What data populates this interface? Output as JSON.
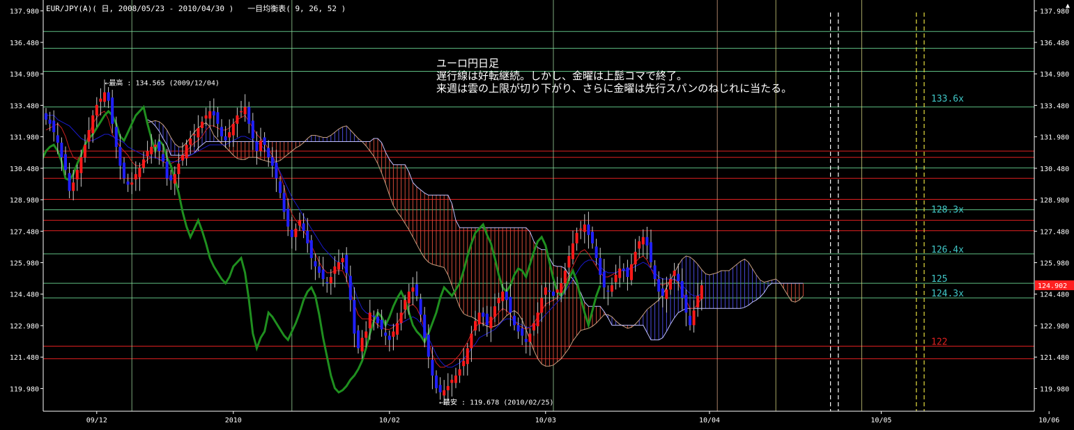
{
  "header": {
    "symbol": "EUR/JPY(A)",
    "period": "日",
    "range": "2008/05/23 - 2010/04/30",
    "indicator": "一目均衡表",
    "params": "9, 26, 52"
  },
  "comment": {
    "title": "ユーロ円日足",
    "line1": "遅行線は好転継続。しかし、金曜は上髭コマで終了。",
    "line2": "来週は雲の上限が切り下がり、さらに金曜は先行スパンのねじれに当たる。"
  },
  "close_icon": "close-triangle-icon",
  "colors": {
    "up": "#ff1a1a",
    "down": "#2020ff",
    "tenkan": "#cc2020",
    "kijun": "#1a1acc",
    "chikou": "#1f8f1f",
    "cloud_bull": "#4a4ad8",
    "cloud_bear": "#d04a38",
    "hline_green": "#7fffb0",
    "hline_red": "#e02020",
    "price_label": "#ff2020",
    "axis": "#ffffff"
  },
  "chart_data": {
    "type": "candlestick",
    "symbol": "EUR/JPY",
    "ylim": [
      118.9,
      138.5
    ],
    "y_ticks": [
      "137.980",
      "136.480",
      "134.980",
      "133.480",
      "131.980",
      "130.480",
      "128.980",
      "127.480",
      "125.980",
      "124.480",
      "122.980",
      "121.480",
      "119.980"
    ],
    "x_ticks": [
      "09/12",
      "2010",
      "10/02",
      "10/03",
      "10/04",
      "10/05",
      "10/06"
    ],
    "x_tick_index": [
      13,
      48,
      88,
      128,
      170,
      214,
      257
    ],
    "last_price": "124.902",
    "annotations": {
      "high": {
        "label": "最高",
        "value": "134.565",
        "date": "2009/12/04"
      },
      "low": {
        "label": "最安",
        "value": "119.678",
        "date": "2010/02/25"
      }
    },
    "levels": [
      {
        "label": "133.6x",
        "value": 133.6,
        "color": "#7fffb0"
      },
      {
        "label": "128.3x",
        "value": 128.3,
        "color": "#7fffb0"
      },
      {
        "label": "126.4x",
        "value": 126.4,
        "color": "#7fffb0"
      },
      {
        "label": "125",
        "value": 125.0,
        "color": "#7fffb0"
      },
      {
        "label": "124.3x",
        "value": 124.3,
        "color": "#7fffb0"
      },
      {
        "label": "122",
        "value": 122.0,
        "color": "#e02020"
      }
    ],
    "green_lines": [
      137.0,
      136.2,
      135.1,
      133.4,
      130.5,
      128.5,
      126.4,
      125.0,
      124.3
    ],
    "red_lines": [
      131.3,
      131.0,
      130.0,
      129.0,
      128.0,
      127.5,
      122.0,
      121.4
    ],
    "vlines": [
      {
        "i": 22,
        "color": "#9ad29a"
      },
      {
        "i": 63,
        "color": "#9ad29a"
      },
      {
        "i": 130,
        "color": "#9ad29a"
      },
      {
        "i": 172,
        "color": "#d4a080"
      },
      {
        "i": 187,
        "color": "#d4d480"
      },
      {
        "i": 209,
        "color": "#d4d480"
      }
    ],
    "dashed_vlines": [
      {
        "i": 201,
        "color": "#ffffff"
      },
      {
        "i": 203,
        "color": "#ffffff"
      },
      {
        "i": 223,
        "color": "#e8e040"
      },
      {
        "i": 225,
        "color": "#e8e040"
      }
    ],
    "closes": [
      132.8,
      132.6,
      132.2,
      131.7,
      131.0,
      130.4,
      129.4,
      129.8,
      130.4,
      131.0,
      131.6,
      132.3,
      133.0,
      133.5,
      133.8,
      134.1,
      133.7,
      132.6,
      131.5,
      130.6,
      130.0,
      129.7,
      129.8,
      130.2,
      130.5,
      130.9,
      131.3,
      131.5,
      131.6,
      131.3,
      130.8,
      130.0,
      129.9,
      130.2,
      130.7,
      131.1,
      131.6,
      131.9,
      132.1,
      132.4,
      132.7,
      133.0,
      133.2,
      133.0,
      132.6,
      132.0,
      131.8,
      132.2,
      132.6,
      133.0,
      133.2,
      133.4,
      132.6,
      131.9,
      131.3,
      131.8,
      131.6,
      131.0,
      130.6,
      130.0,
      129.3,
      128.4,
      127.7,
      127.2,
      127.6,
      128.0,
      127.5,
      126.9,
      126.2,
      125.8,
      125.5,
      125.2,
      125.0,
      125.3,
      125.8,
      126.0,
      126.2,
      125.5,
      124.2,
      122.6,
      121.9,
      122.4,
      122.7,
      123.6,
      123.4,
      123.1,
      122.8,
      122.5,
      122.3,
      122.7,
      123.1,
      123.6,
      124.2,
      124.6,
      124.8,
      124.4,
      123.5,
      122.4,
      121.5,
      120.6,
      120.0,
      119.8,
      119.9,
      120.1,
      120.4,
      120.6,
      120.9,
      121.3,
      121.9,
      122.6,
      123.2,
      123.6,
      123.4,
      123.0,
      123.4,
      123.9,
      124.3,
      124.6,
      124.2,
      123.6,
      123.0,
      122.7,
      122.5,
      122.2,
      122.6,
      123.1,
      123.6,
      124.3,
      124.8,
      124.6,
      124.4,
      124.7,
      125.0,
      125.6,
      126.3,
      126.9,
      127.4,
      127.6,
      127.8,
      127.3,
      126.9,
      126.2,
      125.4,
      124.8,
      124.6,
      124.9,
      125.4,
      125.7,
      125.6,
      125.3,
      125.9,
      126.5,
      127.0,
      127.2,
      126.8,
      126.0,
      125.2,
      124.6,
      124.4,
      124.7,
      125.2,
      125.6,
      125.1,
      124.3,
      123.6,
      123.0,
      123.7,
      124.4,
      124.9
    ],
    "tenkan": [
      132.3,
      132.4,
      132.5,
      132.6,
      132.4,
      132.0,
      131.4,
      131.0,
      130.9,
      131.1,
      131.6,
      132.1,
      132.6,
      132.9,
      133.1,
      133.2,
      132.8,
      132.1,
      131.8,
      131.5,
      131.3,
      131.1,
      130.8,
      130.6,
      130.6,
      130.7,
      130.9,
      131.0,
      131.0,
      130.9,
      130.8,
      130.7,
      130.7,
      130.8,
      130.9,
      131.1,
      131.3,
      131.5,
      131.7,
      131.8,
      132.0,
      132.3,
      132.5,
      132.5,
      132.4,
      132.3,
      132.3,
      132.4,
      132.6,
      132.8,
      132.9,
      133.0,
      132.7,
      132.4,
      132.1,
      131.9,
      131.7,
      131.4,
      131.1,
      130.7,
      130.2,
      129.6,
      128.9,
      128.3,
      128.0,
      127.8,
      127.5,
      127.2,
      126.8,
      126.4,
      126.0,
      125.7,
      125.5,
      125.5,
      125.6,
      125.6,
      125.6,
      125.2,
      124.6,
      124.0,
      123.5,
      123.3,
      123.3,
      123.3,
      123.2,
      123.0,
      122.9,
      122.8,
      122.8,
      122.9,
      123.1,
      123.4,
      123.7,
      123.9,
      124.0,
      123.8,
      123.4,
      122.8,
      122.2,
      121.6,
      121.2,
      121.0,
      121.0,
      121.1,
      121.2,
      121.4,
      121.6,
      121.9,
      122.2,
      122.6,
      122.9,
      123.1,
      123.1,
      123.1,
      123.2,
      123.4,
      123.6,
      123.8,
      123.7,
      123.5,
      123.2,
      123.0,
      122.9,
      122.8,
      122.9,
      123.1,
      123.4,
      123.7,
      124.0,
      124.1,
      124.2,
      124.3,
      124.6,
      125.0,
      125.4,
      125.8,
      126.2,
      126.5,
      126.6,
      126.4,
      126.1,
      125.8,
      125.5,
      125.3,
      125.3,
      125.4,
      125.5,
      125.6,
      125.6,
      125.6,
      125.8,
      126.0,
      126.2,
      126.3,
      126.1,
      125.7,
      125.3,
      125.0,
      124.9,
      125.0,
      125.1,
      125.2,
      125.0,
      124.6,
      124.2,
      123.8,
      123.8,
      124.0,
      124.3
    ],
    "kijun": [
      133.0,
      133.0,
      133.0,
      132.8,
      132.7,
      132.6,
      132.5,
      132.3,
      132.1,
      131.9,
      131.8,
      131.8,
      131.8,
      131.9,
      132.0,
      132.1,
      132.1,
      132.0,
      131.9,
      131.8,
      131.7,
      131.5,
      131.4,
      131.3,
      131.2,
      131.1,
      131.1,
      131.0,
      131.0,
      130.9,
      130.9,
      130.9,
      130.8,
      130.8,
      130.8,
      130.9,
      131.0,
      131.1,
      131.2,
      131.3,
      131.4,
      131.5,
      131.6,
      131.6,
      131.6,
      131.6,
      131.6,
      131.7,
      131.8,
      131.9,
      132.0,
      132.0,
      131.9,
      131.8,
      131.7,
      131.6,
      131.4,
      131.2,
      131.0,
      130.7,
      130.3,
      129.9,
      129.5,
      129.1,
      128.8,
      128.5,
      128.2,
      127.9,
      127.6,
      127.3,
      127.0,
      126.7,
      126.5,
      126.3,
      126.1,
      126.0,
      125.9,
      125.6,
      125.2,
      124.7,
      124.2,
      123.8,
      123.6,
      123.5,
      123.4,
      123.3,
      123.2,
      123.1,
      123.0,
      123.0,
      123.0,
      123.1,
      123.2,
      123.3,
      123.4,
      123.3,
      123.1,
      122.8,
      122.4,
      122.0,
      121.6,
      121.3,
      121.1,
      121.0,
      121.0,
      121.1,
      121.2,
      121.4,
      121.6,
      121.9,
      122.1,
      122.4,
      122.5,
      122.6,
      122.7,
      122.8,
      123.0,
      123.2,
      123.3,
      123.3,
      123.2,
      123.1,
      123.0,
      122.9,
      122.9,
      123.0,
      123.1,
      123.3,
      123.5,
      123.7,
      123.9,
      124.1,
      124.3,
      124.6,
      124.9,
      125.2,
      125.5,
      125.8,
      126.0,
      126.1,
      126.1,
      126.0,
      125.8,
      125.6,
      125.5,
      125.5,
      125.5,
      125.6,
      125.6,
      125.6,
      125.7,
      125.8,
      125.9,
      126.0,
      125.9,
      125.7,
      125.5,
      125.3,
      125.2,
      125.2,
      125.2,
      125.2,
      125.1,
      124.9,
      124.7,
      124.5,
      124.4,
      124.4,
      124.5
    ]
  }
}
